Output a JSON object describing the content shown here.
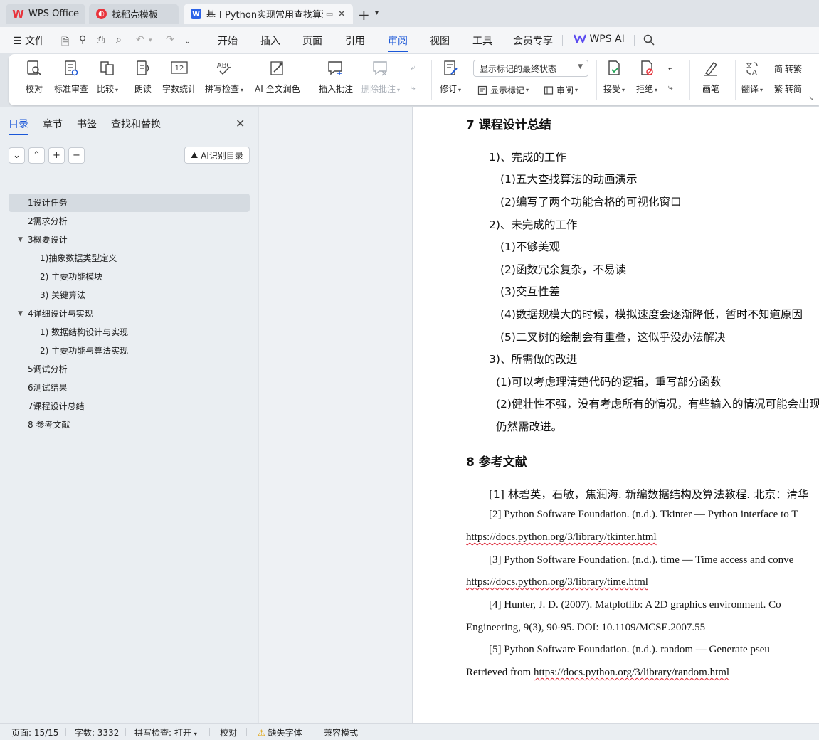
{
  "tabs": {
    "wps_office": "WPS Office",
    "templates": "找稻壳模板",
    "document": "基于Python实现常用查找算法"
  },
  "menu": {
    "file": "文件",
    "items": [
      "开始",
      "插入",
      "页面",
      "引用",
      "审阅",
      "视图",
      "工具",
      "会员专享"
    ],
    "active": "审阅",
    "wps_ai": "WPS AI"
  },
  "ribbon": {
    "proofread": "校对",
    "standard_review": "标准审查",
    "compare": "比较",
    "read_aloud": "朗读",
    "word_count": "字数统计",
    "spell_check": "拼写检查",
    "ai_polish": "AI 全文润色",
    "insert_comment": "插入批注",
    "delete_comment": "删除批注",
    "track_changes": "修订",
    "markup_display": "显示标记的最终状态",
    "show_markup": "显示标记",
    "review_pane": "审阅",
    "accept": "接受",
    "reject": "拒绝",
    "pen": "画笔",
    "translate": "翻译",
    "to_traditional": "转繁",
    "to_simplified": "转简"
  },
  "sidebar": {
    "tabs": [
      "目录",
      "章节",
      "书签",
      "查找和替换"
    ],
    "ai_toc": "AI识别目录",
    "toc": [
      {
        "label": "1设计任务",
        "level": 1,
        "selected": true
      },
      {
        "label": "2需求分析",
        "level": 1
      },
      {
        "label": "3概要设计",
        "level": 1,
        "expanded": true
      },
      {
        "label": "1)抽象数据类型定义",
        "level": 2
      },
      {
        "label": "2) 主要功能模块",
        "level": 2
      },
      {
        "label": "3) 关键算法",
        "level": 2
      },
      {
        "label": "4详细设计与实现",
        "level": 1,
        "expanded": true
      },
      {
        "label": "1) 数据结构设计与实现",
        "level": 2
      },
      {
        "label": "2) 主要功能与算法实现",
        "level": 2
      },
      {
        "label": "5调试分析",
        "level": 1
      },
      {
        "label": "6测试结果",
        "level": 1
      },
      {
        "label": "7课程设计总结",
        "level": 1
      },
      {
        "label": "8 参考文献",
        "level": 1
      }
    ]
  },
  "document": {
    "h7": "7   课程设计总结",
    "s1": "1)、完成的工作",
    "s1_1": "(1)五大查找算法的动画演示",
    "s1_2": "(2)编写了两个功能合格的可视化窗口",
    "s2": "2)、未完成的工作",
    "s2_1": "(1)不够美观",
    "s2_2": "(2)函数冗余复杂，不易读",
    "s2_3": "(3)交互性差",
    "s2_4": "(4)数据规模大的时候，模拟速度会逐渐降低，暂时不知道原因",
    "s2_5": "(5)二叉树的绘制会有重叠，这似乎没办法解决",
    "s3": "3)、所需做的改进",
    "s3_1": "(1)可以考虑理清楚代码的逻辑，重写部分函数",
    "s3_2": "(2)健壮性不强，没有考虑所有的情况，有些输入的情况可能会出现",
    "s3_2b": "仍然需改进。",
    "h8": "8   参考文献",
    "r1": "[1] 林碧英，石敏，焦润海. 新编数据结构及算法教程. 北京：清华",
    "r2": "[2] Python Software Foundation. (n.d.). Tkinter — Python interface to T",
    "r2b": "https://docs.python.org/3/library/tkinter.html",
    "r3": "[3] Python Software Foundation. (n.d.). time — Time access and conve",
    "r3b": "https://docs.python.org/3/library/time.html",
    "r4": "[4] Hunter, J. D. (2007). Matplotlib: A 2D graphics environment. Co",
    "r4b": "Engineering, 9(3), 90-95. DOI: 10.1109/MCSE.2007.55",
    "r5": "[5] Python Software Foundation. (n.d.). random — Generate pseu",
    "r5b_pre": "Retrieved from ",
    "r5b_url": "https://docs.python.org/3/library/random.html"
  },
  "status": {
    "page": "页面: 15/15",
    "words": "字数: 3332",
    "spell": "拼写检查: 打开",
    "proof": "校对",
    "missing_font": "缺失字体",
    "compat": "兼容模式"
  },
  "colors": {
    "accent": "#1a57d8",
    "wps_red": "#e8333b",
    "doc_blue": "#2b62e8"
  }
}
